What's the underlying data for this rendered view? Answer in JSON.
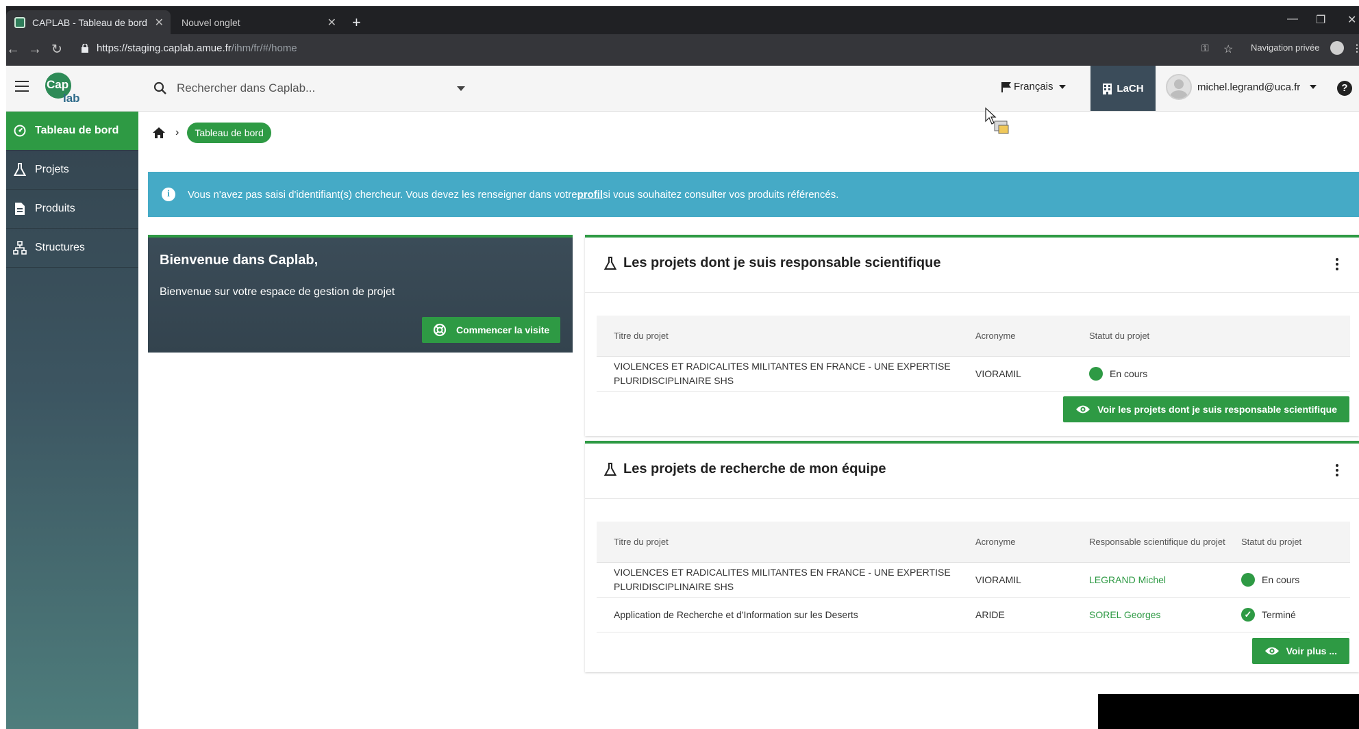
{
  "browser": {
    "active_tab": "CAPLAB - Tableau de bord",
    "inactive_tab": "Nouvel onglet",
    "url_host": "https://staging.caplab.amue.fr",
    "url_path": "/ihm/fr/#/home",
    "private_label": "Navigation privée"
  },
  "header": {
    "logo_cap": "Cap",
    "logo_lab": "lab",
    "search_placeholder": "Rechercher dans Caplab...",
    "language": "Français",
    "structure": "LaCH",
    "user_email": "michel.legrand@uca.fr",
    "help_symbol": "?"
  },
  "sidebar": {
    "items": [
      {
        "label": "Tableau de bord",
        "icon": "dashboard-icon"
      },
      {
        "label": "Projets",
        "icon": "flask-icon"
      },
      {
        "label": "Produits",
        "icon": "document-icon"
      },
      {
        "label": "Structures",
        "icon": "sitemap-icon"
      }
    ]
  },
  "breadcrumb": {
    "current": "Tableau de bord"
  },
  "info": {
    "text_before": "Vous n'avez pas saisi d'identifiant(s) chercheur. Vous devez les renseigner dans votre ",
    "link": "profil",
    "text_after": " si vous souhaitez consulter vos produits référencés."
  },
  "welcome": {
    "title": "Bienvenue dans Caplab,",
    "subtitle": "Bienvenue sur votre espace de gestion de projet",
    "button": "Commencer la visite"
  },
  "card_responsable": {
    "title": "Les projets dont je suis responsable scientifique",
    "columns": [
      "Titre du projet",
      "Acronyme",
      "Statut du projet"
    ],
    "rows": [
      {
        "title_line1": "VIOLENCES ET RADICALITES MILITANTES EN FRANCE - UNE EXPERTISE",
        "title_line2": "PLURIDISCIPLINAIRE SHS",
        "acronym": "VIORAMIL",
        "status": "En cours"
      }
    ],
    "button": "Voir les projets dont je suis responsable scientifique"
  },
  "card_equipe": {
    "title": "Les projets de recherche de mon équipe",
    "columns": [
      "Titre du projet",
      "Acronyme",
      "Responsable scientifique du projet",
      "Statut du projet"
    ],
    "rows": [
      {
        "title_line1": "VIOLENCES ET RADICALITES MILITANTES EN FRANCE - UNE EXPERTISE",
        "title_line2": "PLURIDISCIPLINAIRE SHS",
        "acronym": "VIORAMIL",
        "responsable": "LEGRAND Michel",
        "status": "En cours"
      },
      {
        "title_line1": "Application de Recherche et d'Information sur les Deserts",
        "title_line2": "",
        "acronym": "ARIDE",
        "responsable": "SOREL Georges",
        "status": "Terminé"
      }
    ],
    "button": "Voir plus ..."
  },
  "colors": {
    "accent_green": "#2e9a44",
    "info_blue": "#45aac6",
    "sidebar_dark": "#34444f"
  }
}
